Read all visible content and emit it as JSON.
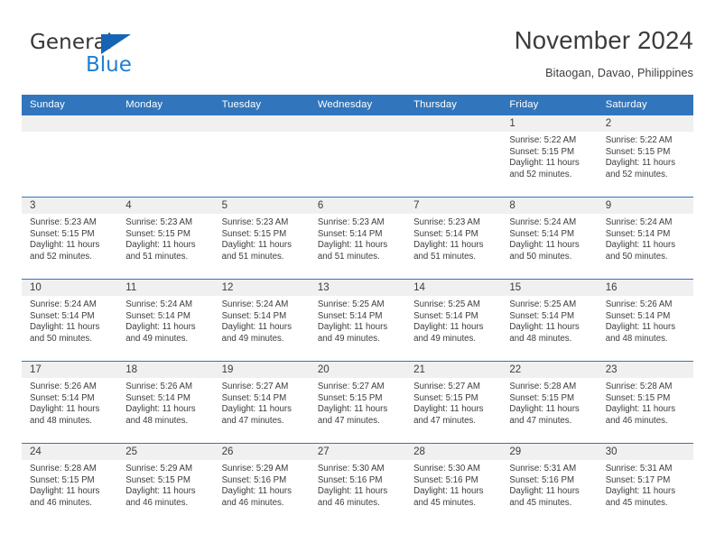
{
  "brand": {
    "name_part1": "General",
    "name_part2": "Blue"
  },
  "header": {
    "title": "November 2024",
    "subtitle": "Bitaogan, Davao, Philippines"
  },
  "colors": {
    "header_blue": "#3176bc",
    "brand_blue": "#1f7fd4",
    "daynum_bg": "#f0f0f0",
    "text": "#3c3c3c"
  },
  "weekday_headers": [
    "Sunday",
    "Monday",
    "Tuesday",
    "Wednesday",
    "Thursday",
    "Friday",
    "Saturday"
  ],
  "labels": {
    "sunrise": "Sunrise:",
    "sunset": "Sunset:",
    "daylight": "Daylight:"
  },
  "weeks": [
    [
      {
        "day": "",
        "sunrise": "",
        "sunset": "",
        "daylight": "",
        "empty": true
      },
      {
        "day": "",
        "sunrise": "",
        "sunset": "",
        "daylight": "",
        "empty": true
      },
      {
        "day": "",
        "sunrise": "",
        "sunset": "",
        "daylight": "",
        "empty": true
      },
      {
        "day": "",
        "sunrise": "",
        "sunset": "",
        "daylight": "",
        "empty": true
      },
      {
        "day": "",
        "sunrise": "",
        "sunset": "",
        "daylight": "",
        "empty": true
      },
      {
        "day": "1",
        "sunrise": "Sunrise: 5:22 AM",
        "sunset": "Sunset: 5:15 PM",
        "daylight": "Daylight: 11 hours and 52 minutes."
      },
      {
        "day": "2",
        "sunrise": "Sunrise: 5:22 AM",
        "sunset": "Sunset: 5:15 PM",
        "daylight": "Daylight: 11 hours and 52 minutes."
      }
    ],
    [
      {
        "day": "3",
        "sunrise": "Sunrise: 5:23 AM",
        "sunset": "Sunset: 5:15 PM",
        "daylight": "Daylight: 11 hours and 52 minutes."
      },
      {
        "day": "4",
        "sunrise": "Sunrise: 5:23 AM",
        "sunset": "Sunset: 5:15 PM",
        "daylight": "Daylight: 11 hours and 51 minutes."
      },
      {
        "day": "5",
        "sunrise": "Sunrise: 5:23 AM",
        "sunset": "Sunset: 5:15 PM",
        "daylight": "Daylight: 11 hours and 51 minutes."
      },
      {
        "day": "6",
        "sunrise": "Sunrise: 5:23 AM",
        "sunset": "Sunset: 5:14 PM",
        "daylight": "Daylight: 11 hours and 51 minutes."
      },
      {
        "day": "7",
        "sunrise": "Sunrise: 5:23 AM",
        "sunset": "Sunset: 5:14 PM",
        "daylight": "Daylight: 11 hours and 51 minutes."
      },
      {
        "day": "8",
        "sunrise": "Sunrise: 5:24 AM",
        "sunset": "Sunset: 5:14 PM",
        "daylight": "Daylight: 11 hours and 50 minutes."
      },
      {
        "day": "9",
        "sunrise": "Sunrise: 5:24 AM",
        "sunset": "Sunset: 5:14 PM",
        "daylight": "Daylight: 11 hours and 50 minutes."
      }
    ],
    [
      {
        "day": "10",
        "sunrise": "Sunrise: 5:24 AM",
        "sunset": "Sunset: 5:14 PM",
        "daylight": "Daylight: 11 hours and 50 minutes."
      },
      {
        "day": "11",
        "sunrise": "Sunrise: 5:24 AM",
        "sunset": "Sunset: 5:14 PM",
        "daylight": "Daylight: 11 hours and 49 minutes."
      },
      {
        "day": "12",
        "sunrise": "Sunrise: 5:24 AM",
        "sunset": "Sunset: 5:14 PM",
        "daylight": "Daylight: 11 hours and 49 minutes."
      },
      {
        "day": "13",
        "sunrise": "Sunrise: 5:25 AM",
        "sunset": "Sunset: 5:14 PM",
        "daylight": "Daylight: 11 hours and 49 minutes."
      },
      {
        "day": "14",
        "sunrise": "Sunrise: 5:25 AM",
        "sunset": "Sunset: 5:14 PM",
        "daylight": "Daylight: 11 hours and 49 minutes."
      },
      {
        "day": "15",
        "sunrise": "Sunrise: 5:25 AM",
        "sunset": "Sunset: 5:14 PM",
        "daylight": "Daylight: 11 hours and 48 minutes."
      },
      {
        "day": "16",
        "sunrise": "Sunrise: 5:26 AM",
        "sunset": "Sunset: 5:14 PM",
        "daylight": "Daylight: 11 hours and 48 minutes."
      }
    ],
    [
      {
        "day": "17",
        "sunrise": "Sunrise: 5:26 AM",
        "sunset": "Sunset: 5:14 PM",
        "daylight": "Daylight: 11 hours and 48 minutes."
      },
      {
        "day": "18",
        "sunrise": "Sunrise: 5:26 AM",
        "sunset": "Sunset: 5:14 PM",
        "daylight": "Daylight: 11 hours and 48 minutes."
      },
      {
        "day": "19",
        "sunrise": "Sunrise: 5:27 AM",
        "sunset": "Sunset: 5:14 PM",
        "daylight": "Daylight: 11 hours and 47 minutes."
      },
      {
        "day": "20",
        "sunrise": "Sunrise: 5:27 AM",
        "sunset": "Sunset: 5:15 PM",
        "daylight": "Daylight: 11 hours and 47 minutes."
      },
      {
        "day": "21",
        "sunrise": "Sunrise: 5:27 AM",
        "sunset": "Sunset: 5:15 PM",
        "daylight": "Daylight: 11 hours and 47 minutes."
      },
      {
        "day": "22",
        "sunrise": "Sunrise: 5:28 AM",
        "sunset": "Sunset: 5:15 PM",
        "daylight": "Daylight: 11 hours and 47 minutes."
      },
      {
        "day": "23",
        "sunrise": "Sunrise: 5:28 AM",
        "sunset": "Sunset: 5:15 PM",
        "daylight": "Daylight: 11 hours and 46 minutes."
      }
    ],
    [
      {
        "day": "24",
        "sunrise": "Sunrise: 5:28 AM",
        "sunset": "Sunset: 5:15 PM",
        "daylight": "Daylight: 11 hours and 46 minutes."
      },
      {
        "day": "25",
        "sunrise": "Sunrise: 5:29 AM",
        "sunset": "Sunset: 5:15 PM",
        "daylight": "Daylight: 11 hours and 46 minutes."
      },
      {
        "day": "26",
        "sunrise": "Sunrise: 5:29 AM",
        "sunset": "Sunset: 5:16 PM",
        "daylight": "Daylight: 11 hours and 46 minutes."
      },
      {
        "day": "27",
        "sunrise": "Sunrise: 5:30 AM",
        "sunset": "Sunset: 5:16 PM",
        "daylight": "Daylight: 11 hours and 46 minutes."
      },
      {
        "day": "28",
        "sunrise": "Sunrise: 5:30 AM",
        "sunset": "Sunset: 5:16 PM",
        "daylight": "Daylight: 11 hours and 45 minutes."
      },
      {
        "day": "29",
        "sunrise": "Sunrise: 5:31 AM",
        "sunset": "Sunset: 5:16 PM",
        "daylight": "Daylight: 11 hours and 45 minutes."
      },
      {
        "day": "30",
        "sunrise": "Sunrise: 5:31 AM",
        "sunset": "Sunset: 5:17 PM",
        "daylight": "Daylight: 11 hours and 45 minutes."
      }
    ]
  ]
}
